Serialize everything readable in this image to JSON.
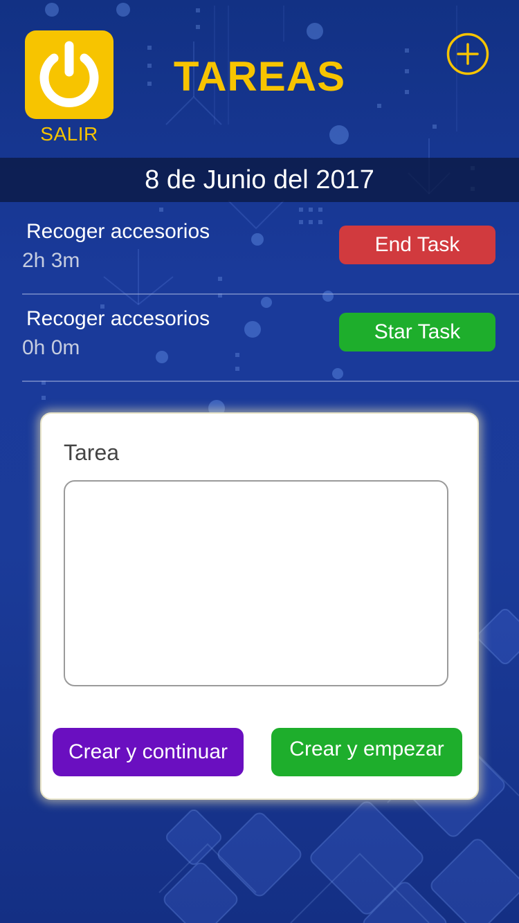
{
  "header": {
    "title": "TAREAS",
    "exit_label": "SALIR",
    "exit_icon": "power-icon",
    "add_icon": "plus-circle-icon"
  },
  "date_bar": {
    "text": "8 de Junio del 2017"
  },
  "tasks": [
    {
      "name": "Recoger accesorios",
      "time": "2h 3m",
      "action": "End Task",
      "action_color": "#d13a3e"
    },
    {
      "name": "Recoger accesorios",
      "time": "0h 0m",
      "action": "Star Task",
      "action_color": "#1eae2c"
    }
  ],
  "modal": {
    "label": "Tarea",
    "input_value": "",
    "create_continue": "Crear y continuar",
    "create_start": "Crear y empezar"
  },
  "colors": {
    "accent_yellow": "#f7c400",
    "end_red": "#d13a3e",
    "start_green": "#1eae2c",
    "continue_purple": "#6a0fc0",
    "background_blue": "#1a3a9a"
  }
}
